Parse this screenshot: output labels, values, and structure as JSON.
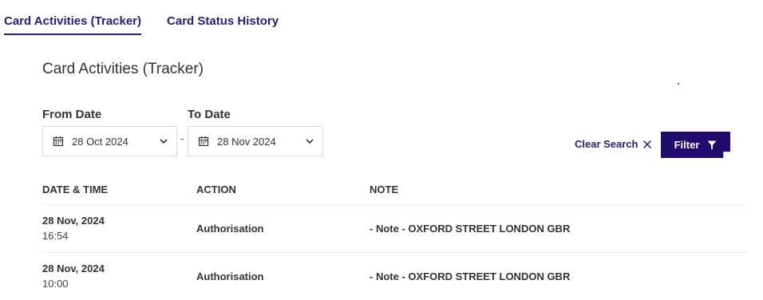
{
  "tabs": [
    {
      "label": "Card Activities (Tracker)",
      "active": true
    },
    {
      "label": "Card Status History",
      "active": false
    }
  ],
  "page_title": "Card Activities (Tracker)",
  "filters": {
    "from_label": "From Date",
    "from_value": "28 Oct 2024",
    "separator": "-",
    "to_label": "To Date",
    "to_value": "28 Nov 2024",
    "clear_label": "Clear Search",
    "filter_label": "Filter"
  },
  "table": {
    "headers": [
      "DATE & TIME",
      "ACTION",
      "NOTE"
    ],
    "rows": [
      {
        "date": "28 Nov, 2024",
        "time": "16:54",
        "action": "Authorisation",
        "note": "- Note - OXFORD STREET LONDON GBR"
      },
      {
        "date": "28 Nov, 2024",
        "time": "10:00",
        "action": "Authorisation",
        "note": "- Note - OXFORD STREET LONDON GBR"
      }
    ]
  },
  "colors": {
    "accent": "#2a1a7a",
    "button": "#1f0a6e"
  },
  "icons": [
    "calendar-icon",
    "chevron-down-icon",
    "close-icon",
    "filter-icon"
  ]
}
